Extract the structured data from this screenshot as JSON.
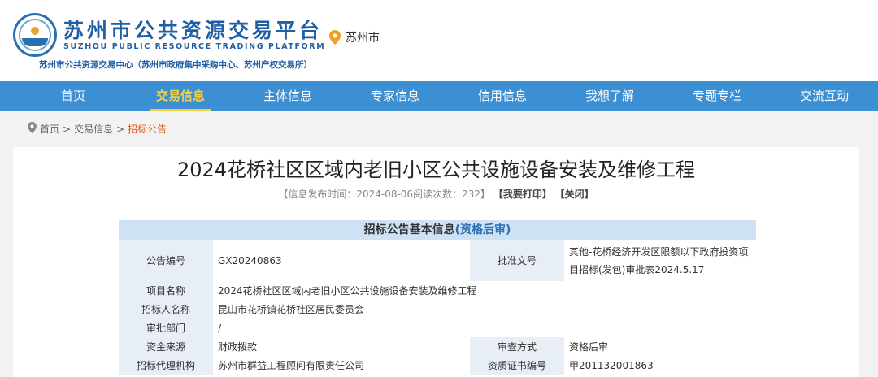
{
  "header": {
    "title": "苏州市公共资源交易平台",
    "title_en": "SUZHOU PUBLIC RESOURCE TRADING PLATFORM",
    "subtitle": "苏州市公共资源交易中心（苏州市政府集中采购中心、苏州产权交易所）",
    "city": "苏州市"
  },
  "nav": {
    "items": [
      {
        "label": "首页"
      },
      {
        "label": "交易信息"
      },
      {
        "label": "主体信息"
      },
      {
        "label": "专家信息"
      },
      {
        "label": "信用信息"
      },
      {
        "label": "我想了解"
      },
      {
        "label": "专题专栏"
      },
      {
        "label": "交流互动"
      }
    ],
    "active_index": 1
  },
  "breadcrumb": {
    "home": "首页",
    "sep": ">",
    "level1": "交易信息",
    "current": "招标公告"
  },
  "article": {
    "title": "2024花桥社区区域内老旧小区公共设施设备安装及维修工程",
    "meta_prefix": "【信息发布时间：2024-08-06阅读次数：232】",
    "print_label": "【我要打印】",
    "close_label": "【关闭】"
  },
  "section": {
    "heading_main": "招标公告基本信息",
    "heading_hl": "(资格后审)"
  },
  "table": {
    "notice_no_label": "公告编号",
    "notice_no": "GX20240863",
    "approval_doc_label": "批准文号",
    "approval_doc": "其他-花桥经济开发区限额以下政府投资项目招标(发包)审批表2024.5.17",
    "project_name_label": "项目名称",
    "project_name": "2024花桥社区区域内老旧小区公共设施设备安装及维修工程",
    "tenderer_label": "招标人名称",
    "tenderer": "昆山市花桥镇花桥社区居民委员会",
    "approval_dept_label": "审批部门",
    "approval_dept": "/",
    "fund_source_label": "资金来源",
    "fund_source": "财政拨款",
    "review_method_label": "审查方式",
    "review_method": "资格后审",
    "agency_label": "招标代理机构",
    "agency": "苏州市群益工程顾问有限责任公司",
    "cert_no_label": "资质证书编号",
    "cert_no": "甲201132001863"
  },
  "colors": {
    "brand": "#1f5fa6",
    "nav_bg": "#3d8fd4",
    "nav_active": "#f5d142",
    "breadcrumb_current": "#e05a1a"
  }
}
